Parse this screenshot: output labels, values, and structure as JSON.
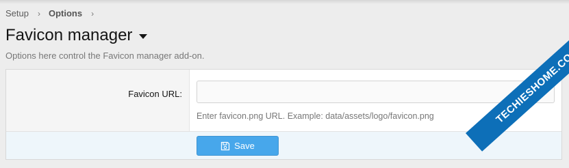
{
  "breadcrumb": {
    "items": [
      "Setup",
      "Options"
    ],
    "separator": "›"
  },
  "page": {
    "title": "Favicon manager",
    "description": "Options here control the Favicon manager add-on."
  },
  "form": {
    "field_label": "Favicon URL:",
    "field_value": "",
    "field_hint": "Enter favicon.png URL. Example: data/assets/logo/favicon.png",
    "save_label": "Save"
  },
  "watermark": {
    "text": "TECHIESHOME.COM"
  },
  "colors": {
    "accent": "#47a7eb",
    "watermark": "#0d6fb8"
  },
  "icons": {
    "title_menu": "caret-down-icon",
    "breadcrumb_separator": "chevron-right-icon",
    "save": "floppy-disk-icon"
  }
}
